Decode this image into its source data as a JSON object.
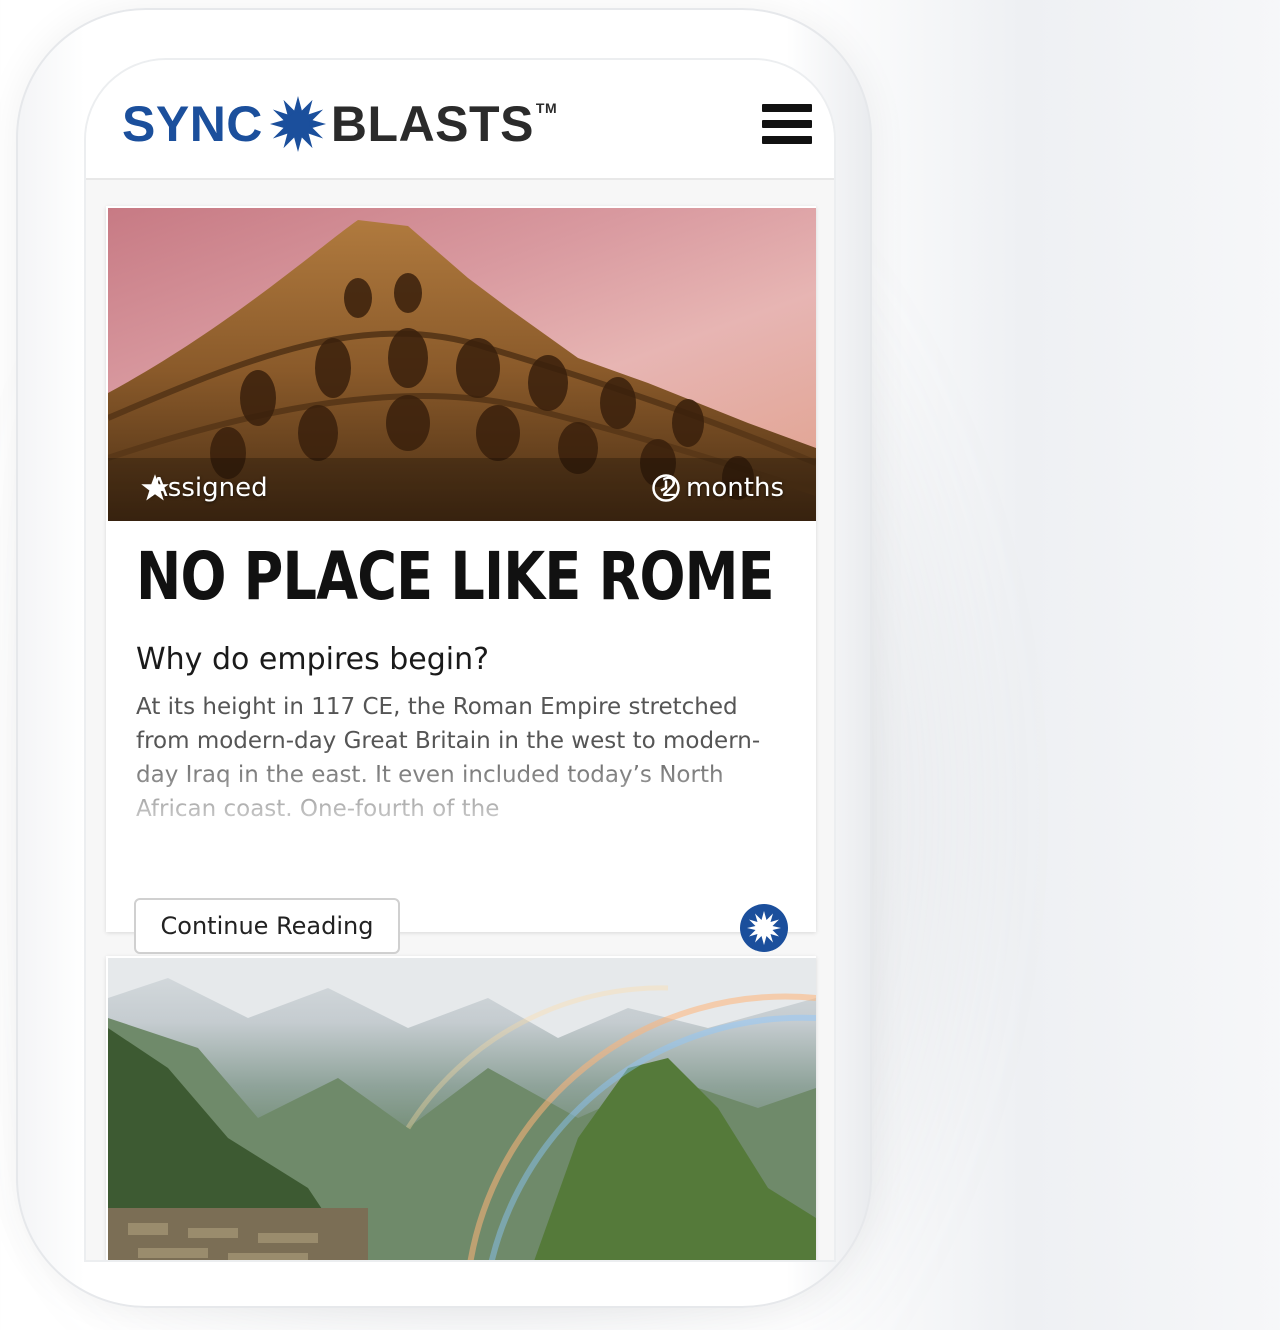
{
  "header": {
    "logo_part1": "SYNC",
    "logo_part2": "BLASTS",
    "logo_tm": "TM",
    "logo_icon": "starburst-icon",
    "menu_icon": "hamburger-menu-icon"
  },
  "colors": {
    "brand_blue": "#1b4f9c",
    "brand_dark": "#2b2b2b"
  },
  "cards": [
    {
      "status": "Assigned",
      "status_icon": "star-icon",
      "time": "2 months",
      "time_icon": "clock-icon",
      "title": "NO PLACE LIKE ROME",
      "question": "Why do empires begin?",
      "excerpt": "At its height in 117 CE, the Roman Empire stretched from modern-day Great Britain in the west to modern-day Iraq in the east. It even included today’s North African coast. One-fourth of the",
      "button": "Continue Reading",
      "badge_icon": "syncblasts-badge-icon"
    }
  ]
}
